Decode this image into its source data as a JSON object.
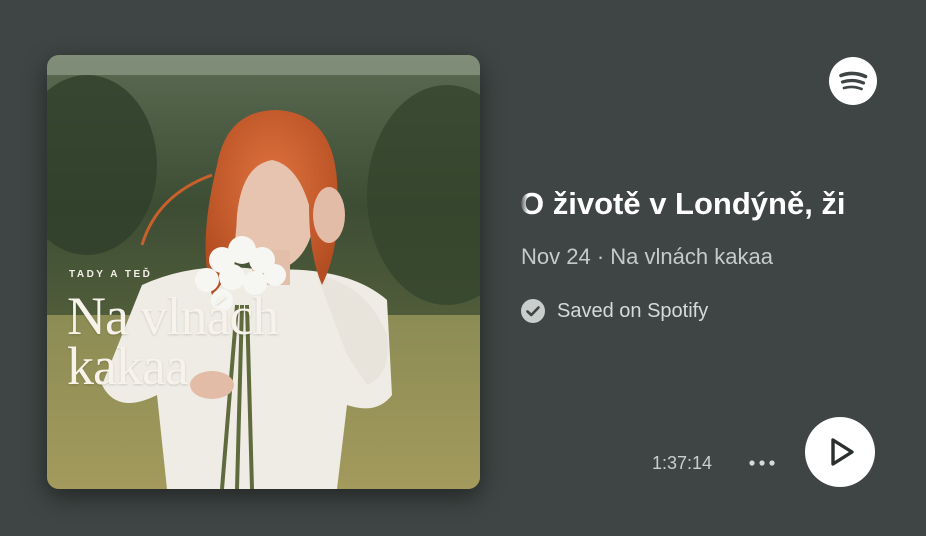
{
  "cover": {
    "kicker": "TADY A TEĎ",
    "title_line1": "Na vlnách",
    "title_line2": "kakaa"
  },
  "episode": {
    "title": "O životě v Londýně, ži",
    "date": "Nov 24",
    "separator": "·",
    "show": "Na vlnách kakaa"
  },
  "saved": {
    "label": "Saved on Spotify"
  },
  "controls": {
    "duration": "1:37:14"
  },
  "icons": {
    "logo": "spotify-icon",
    "check": "check-circle-icon",
    "more": "more-horizontal-icon",
    "play": "play-icon"
  },
  "colors": {
    "background": "#3f4544",
    "accent": "#ffffff",
    "muted": "#c6cbca"
  }
}
